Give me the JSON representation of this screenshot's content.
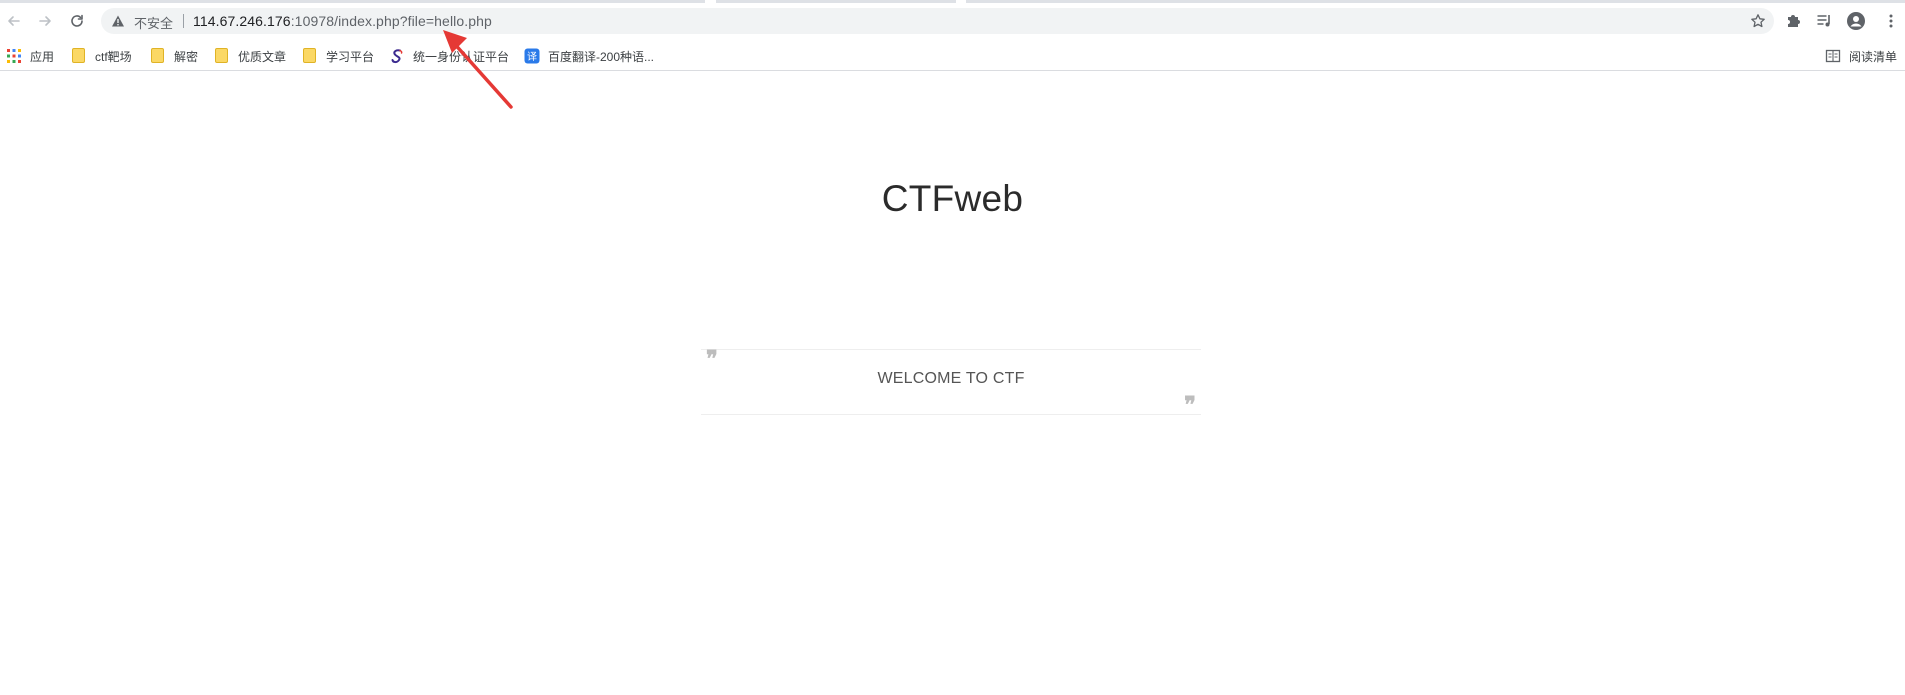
{
  "browser": {
    "security_label": "不安全",
    "url_host": "114.67.246.176",
    "url_rest": ":10978/index.php?file=hello.php",
    "icons": {
      "back": "arrow-left",
      "forward": "arrow-right",
      "reload": "reload",
      "security": "warning-triangle",
      "bookmark": "star",
      "extensions": "puzzle",
      "media": "playlist",
      "profile": "avatar",
      "menu": "kebab"
    }
  },
  "bookmarks": {
    "apps_label": "应用",
    "items": [
      {
        "label": "ctf靶场",
        "icon": "folder"
      },
      {
        "label": "解密",
        "icon": "folder"
      },
      {
        "label": "优质文章",
        "icon": "folder"
      },
      {
        "label": "学习平台",
        "icon": "folder"
      },
      {
        "label": "统一身份认证平台",
        "icon": "swirl-logo"
      },
      {
        "label": "百度翻译-200种语...",
        "icon": "translate"
      }
    ],
    "reading_list_label": "阅读清单"
  },
  "page": {
    "title": "CTFweb",
    "quote": "WELCOME TO CTF",
    "open_quote": "❞",
    "close_quote": "❞"
  },
  "colors": {
    "annotation_arrow": "#e53935",
    "omnibox_bg": "#f1f3f4",
    "folder": "#fbd865"
  }
}
